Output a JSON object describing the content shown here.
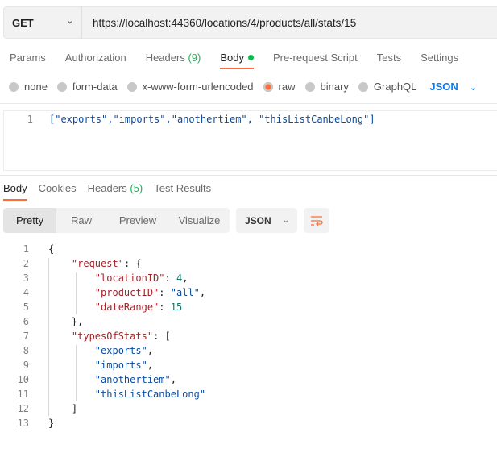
{
  "request": {
    "method": "GET",
    "url": "https://localhost:44360/locations/4/products/all/stats/15"
  },
  "request_tabs": [
    {
      "label": "Params"
    },
    {
      "label": "Authorization"
    },
    {
      "label": "Headers",
      "count": "(9)"
    },
    {
      "label": "Body",
      "active": true
    },
    {
      "label": "Pre-request Script"
    },
    {
      "label": "Tests"
    },
    {
      "label": "Settings"
    }
  ],
  "body_types": [
    {
      "label": "none"
    },
    {
      "label": "form-data"
    },
    {
      "label": "x-www-form-urlencoded"
    },
    {
      "label": "raw",
      "selected": true
    },
    {
      "label": "binary"
    },
    {
      "label": "GraphQL"
    }
  ],
  "raw_format": "JSON",
  "request_body": {
    "line_number": "1",
    "text": "[\"exports\",\"imports\",\"anothertiem\", \"thisListCanbeLong\"]"
  },
  "response_tabs": [
    {
      "label": "Body",
      "active": true
    },
    {
      "label": "Cookies"
    },
    {
      "label": "Headers",
      "count": "(5)"
    },
    {
      "label": "Test Results"
    }
  ],
  "view_tabs": [
    {
      "label": "Pretty",
      "active": true
    },
    {
      "label": "Raw"
    },
    {
      "label": "Preview"
    },
    {
      "label": "Visualize"
    }
  ],
  "response_format": "JSON",
  "colors": {
    "accent": "#ff6c37",
    "success": "#0cbb52",
    "link": "#097bed"
  },
  "response_lines": [
    [
      {
        "t": "{",
        "c": "pun"
      }
    ],
    [
      {
        "t": "    "
      },
      {
        "t": "\"request\"",
        "c": "key"
      },
      {
        "t": ": {",
        "c": "pun"
      }
    ],
    [
      {
        "t": "        "
      },
      {
        "t": "\"locationID\"",
        "c": "key"
      },
      {
        "t": ": ",
        "c": "pun"
      },
      {
        "t": "4",
        "c": "num"
      },
      {
        "t": ",",
        "c": "pun"
      }
    ],
    [
      {
        "t": "        "
      },
      {
        "t": "\"productID\"",
        "c": "key"
      },
      {
        "t": ": ",
        "c": "pun"
      },
      {
        "t": "\"all\"",
        "c": "str"
      },
      {
        "t": ",",
        "c": "pun"
      }
    ],
    [
      {
        "t": "        "
      },
      {
        "t": "\"dateRange\"",
        "c": "key"
      },
      {
        "t": ": ",
        "c": "pun"
      },
      {
        "t": "15",
        "c": "num"
      }
    ],
    [
      {
        "t": "    "
      },
      {
        "t": "},",
        "c": "pun"
      }
    ],
    [
      {
        "t": "    "
      },
      {
        "t": "\"typesOfStats\"",
        "c": "key"
      },
      {
        "t": ": [",
        "c": "pun"
      }
    ],
    [
      {
        "t": "        "
      },
      {
        "t": "\"exports\"",
        "c": "str"
      },
      {
        "t": ",",
        "c": "pun"
      }
    ],
    [
      {
        "t": "        "
      },
      {
        "t": "\"imports\"",
        "c": "str"
      },
      {
        "t": ",",
        "c": "pun"
      }
    ],
    [
      {
        "t": "        "
      },
      {
        "t": "\"anothertiem\"",
        "c": "str"
      },
      {
        "t": ",",
        "c": "pun"
      }
    ],
    [
      {
        "t": "        "
      },
      {
        "t": "\"thisListCanbeLong\"",
        "c": "str"
      }
    ],
    [
      {
        "t": "    "
      },
      {
        "t": "]",
        "c": "pun"
      }
    ],
    [
      {
        "t": "}",
        "c": "pun"
      }
    ]
  ]
}
